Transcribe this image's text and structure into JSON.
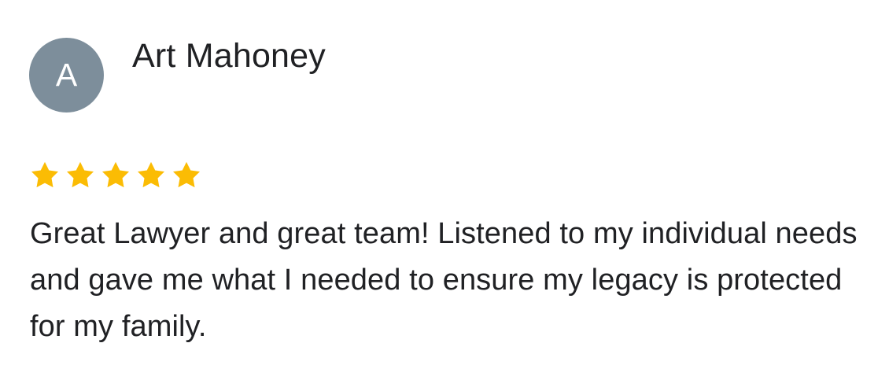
{
  "review": {
    "avatar_initial": "A",
    "avatar_color": "#7d8e9b",
    "reviewer_name": "Art Mahoney",
    "rating": 5,
    "rating_max": 5,
    "star_color": "#fbbc04",
    "star_icon": "star-icon",
    "text": "Great Lawyer and great team! Listened to my individual needs and gave me what I needed to ensure my legacy is protected for my family."
  }
}
